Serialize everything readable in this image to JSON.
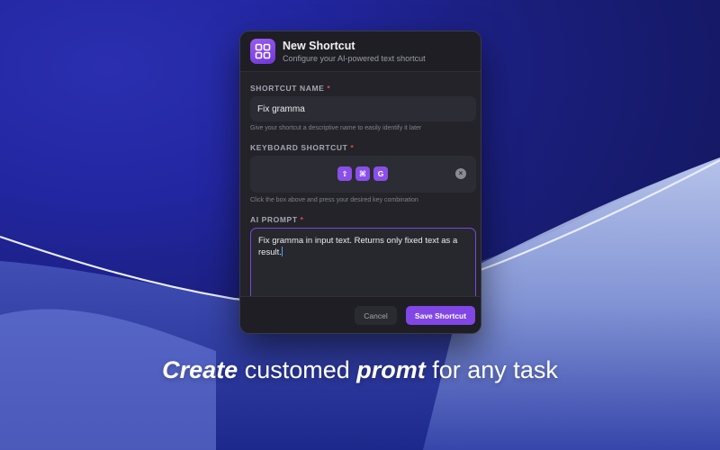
{
  "dialog": {
    "title": "New Shortcut",
    "subtitle": "Configure your AI-powered text shortcut",
    "icon": "grid-icon",
    "accent_color": "#8047e6"
  },
  "shortcut_name": {
    "label": "SHORTCUT NAME",
    "required_mark": "*",
    "value": "Fix gramma",
    "hint": "Give your shortcut a descriptive name to easily identify it later"
  },
  "keyboard_shortcut": {
    "label": "KEYBOARD SHORTCUT",
    "required_mark": "*",
    "keys": [
      "⇧",
      "⌘",
      "G"
    ],
    "clear_icon": "clear-circle-icon",
    "hint": "Click the box above and press your desired key combination"
  },
  "ai_prompt": {
    "label": "AI PROMPT",
    "required_mark": "*",
    "value": "Fix gramma in input text. Returns only fixed text as a result."
  },
  "footer": {
    "cancel_label": "Cancel",
    "save_label": "Save Shortcut"
  },
  "tagline": {
    "word1": "Create",
    "word2": " customed ",
    "word3": "promt",
    "word4": " for any task"
  }
}
